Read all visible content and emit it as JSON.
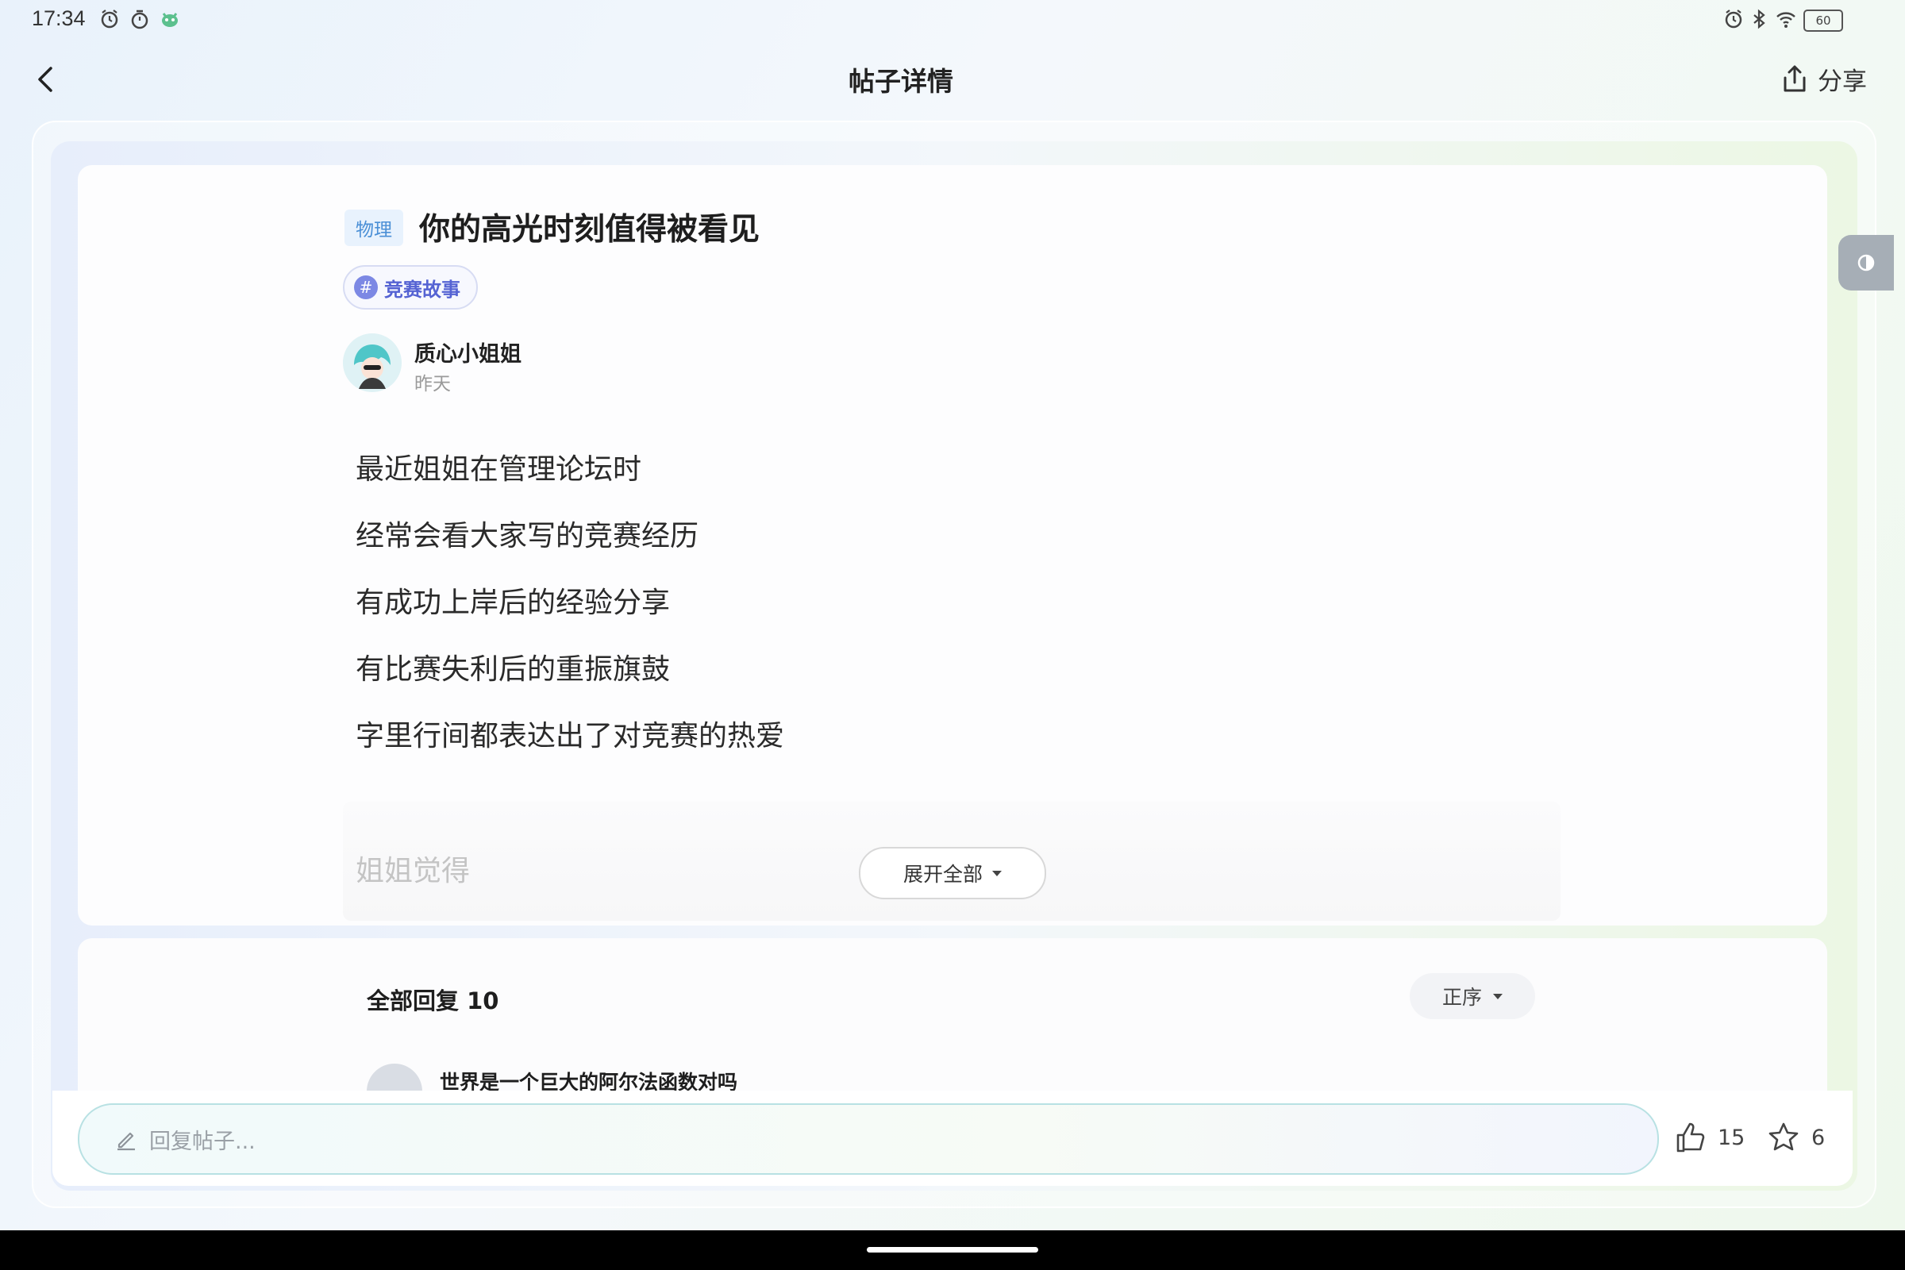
{
  "status_bar": {
    "time": "17:34",
    "battery": "60"
  },
  "header": {
    "title": "帖子详情",
    "share_label": "分享"
  },
  "post": {
    "subject_tag": "物理",
    "title": "你的高光时刻值得被看见",
    "topic": "竞赛故事",
    "author": "质心小姐姐",
    "time": "昨天",
    "body": [
      "最近姐姐在管理论坛时",
      "经常会看大家写的竞赛经历",
      "有成功上岸后的经验分享",
      "有比赛失利后的重振旗鼓",
      "字里行间都表达出了对竞赛的热爱"
    ],
    "fade_line": "姐姐觉得",
    "expand_label": "展开全部"
  },
  "replies": {
    "heading": "全部回复 10",
    "sort_label": "正序",
    "first_reply_title": "世界是一个巨大的阿尔法函数对吗"
  },
  "bottom_bar": {
    "placeholder": "回复帖子...",
    "like_count": "15",
    "favorite_count": "6"
  }
}
